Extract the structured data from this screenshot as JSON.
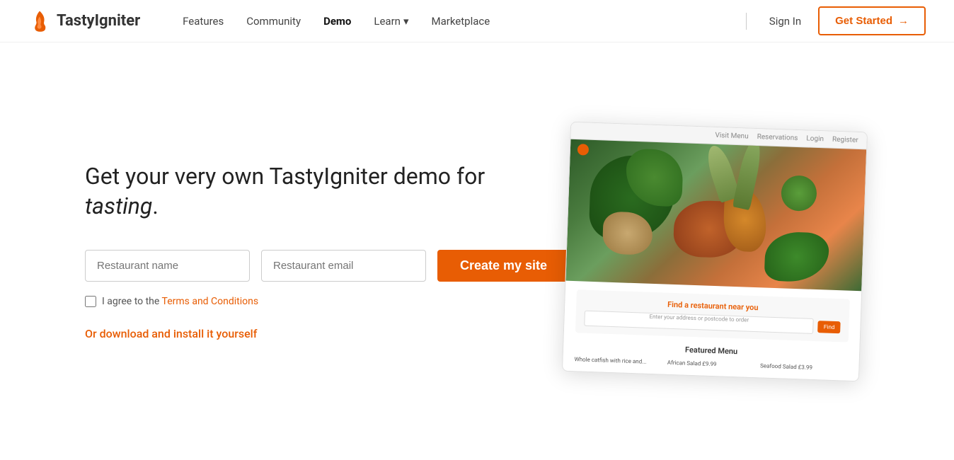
{
  "brand": {
    "name": "TastyIgniter",
    "logo_alt": "TastyIgniter flame logo"
  },
  "nav": {
    "links": [
      {
        "id": "features",
        "label": "Features",
        "active": false,
        "has_dropdown": false
      },
      {
        "id": "community",
        "label": "Community",
        "active": false,
        "has_dropdown": false
      },
      {
        "id": "demo",
        "label": "Demo",
        "active": true,
        "has_dropdown": false
      },
      {
        "id": "learn",
        "label": "Learn",
        "active": false,
        "has_dropdown": true
      },
      {
        "id": "marketplace",
        "label": "Marketplace",
        "active": false,
        "has_dropdown": false
      }
    ],
    "sign_in": "Sign In",
    "get_started": "Get Started",
    "get_started_arrow": "→"
  },
  "hero": {
    "heading_prefix": "Get your very own TastyIgniter demo for ",
    "heading_italic": "tasting",
    "heading_suffix": "."
  },
  "form": {
    "restaurant_name_placeholder": "Restaurant name",
    "restaurant_email_placeholder": "Restaurant email",
    "create_button": "Create my site",
    "agree_prefix": "I agree to the ",
    "terms_link": "Terms and Conditions"
  },
  "download": {
    "label": "Or download and install it yourself"
  },
  "preview": {
    "nav_links": [
      "Visit Menu",
      "Reservations",
      "Login",
      "Register"
    ],
    "search_title": "Find a restaurant near you",
    "search_placeholder": "Enter your address or postcode to order",
    "search_btn": "Find",
    "featured_menu": "Featured Menu",
    "menu_items": [
      "Whole catfish with rice and...",
      "African Salad £9.99",
      "Seafood Salad £3.99"
    ]
  },
  "colors": {
    "accent": "#e85d04",
    "text_dark": "#222",
    "text_muted": "#555"
  }
}
